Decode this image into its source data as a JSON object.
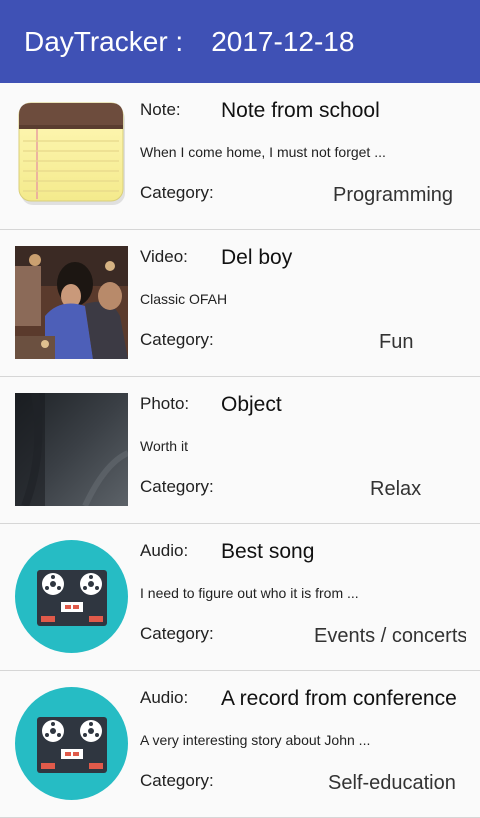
{
  "header": {
    "app_name": "DayTracker :",
    "date": "2017-12-18"
  },
  "items": [
    {
      "type": "Note:",
      "title": "Note from school",
      "description": "When I come home, I must not forget ...",
      "category_label": "Category:",
      "category": "Programming",
      "thumbnail": "notepad-icon"
    },
    {
      "type": "Video:",
      "title": "Del boy",
      "description": "Classic OFAH",
      "category_label": "Category:",
      "category": "Fun",
      "thumbnail": "video-thumbnail"
    },
    {
      "type": "Photo:",
      "title": "Object",
      "description": "Worth it",
      "category_label": "Category:",
      "category": "Relax",
      "thumbnail": "photo-thumbnail"
    },
    {
      "type": "Audio:",
      "title": "Best song",
      "description": "I need to figure out who it is from ...",
      "category_label": "Category:",
      "category": "Events / concerts",
      "thumbnail": "tape-recorder-icon"
    },
    {
      "type": "Audio:",
      "title": "A record from conference",
      "description": "A very interesting story about John ...",
      "category_label": "Category:",
      "category": "Self-education",
      "thumbnail": "tape-recorder-icon"
    }
  ],
  "colors": {
    "appbar": "#3f51b5",
    "audio_circle": "#26bcc4",
    "notepad_top": "#6d4c3d",
    "notepad_paper": "#fdf6a6"
  }
}
